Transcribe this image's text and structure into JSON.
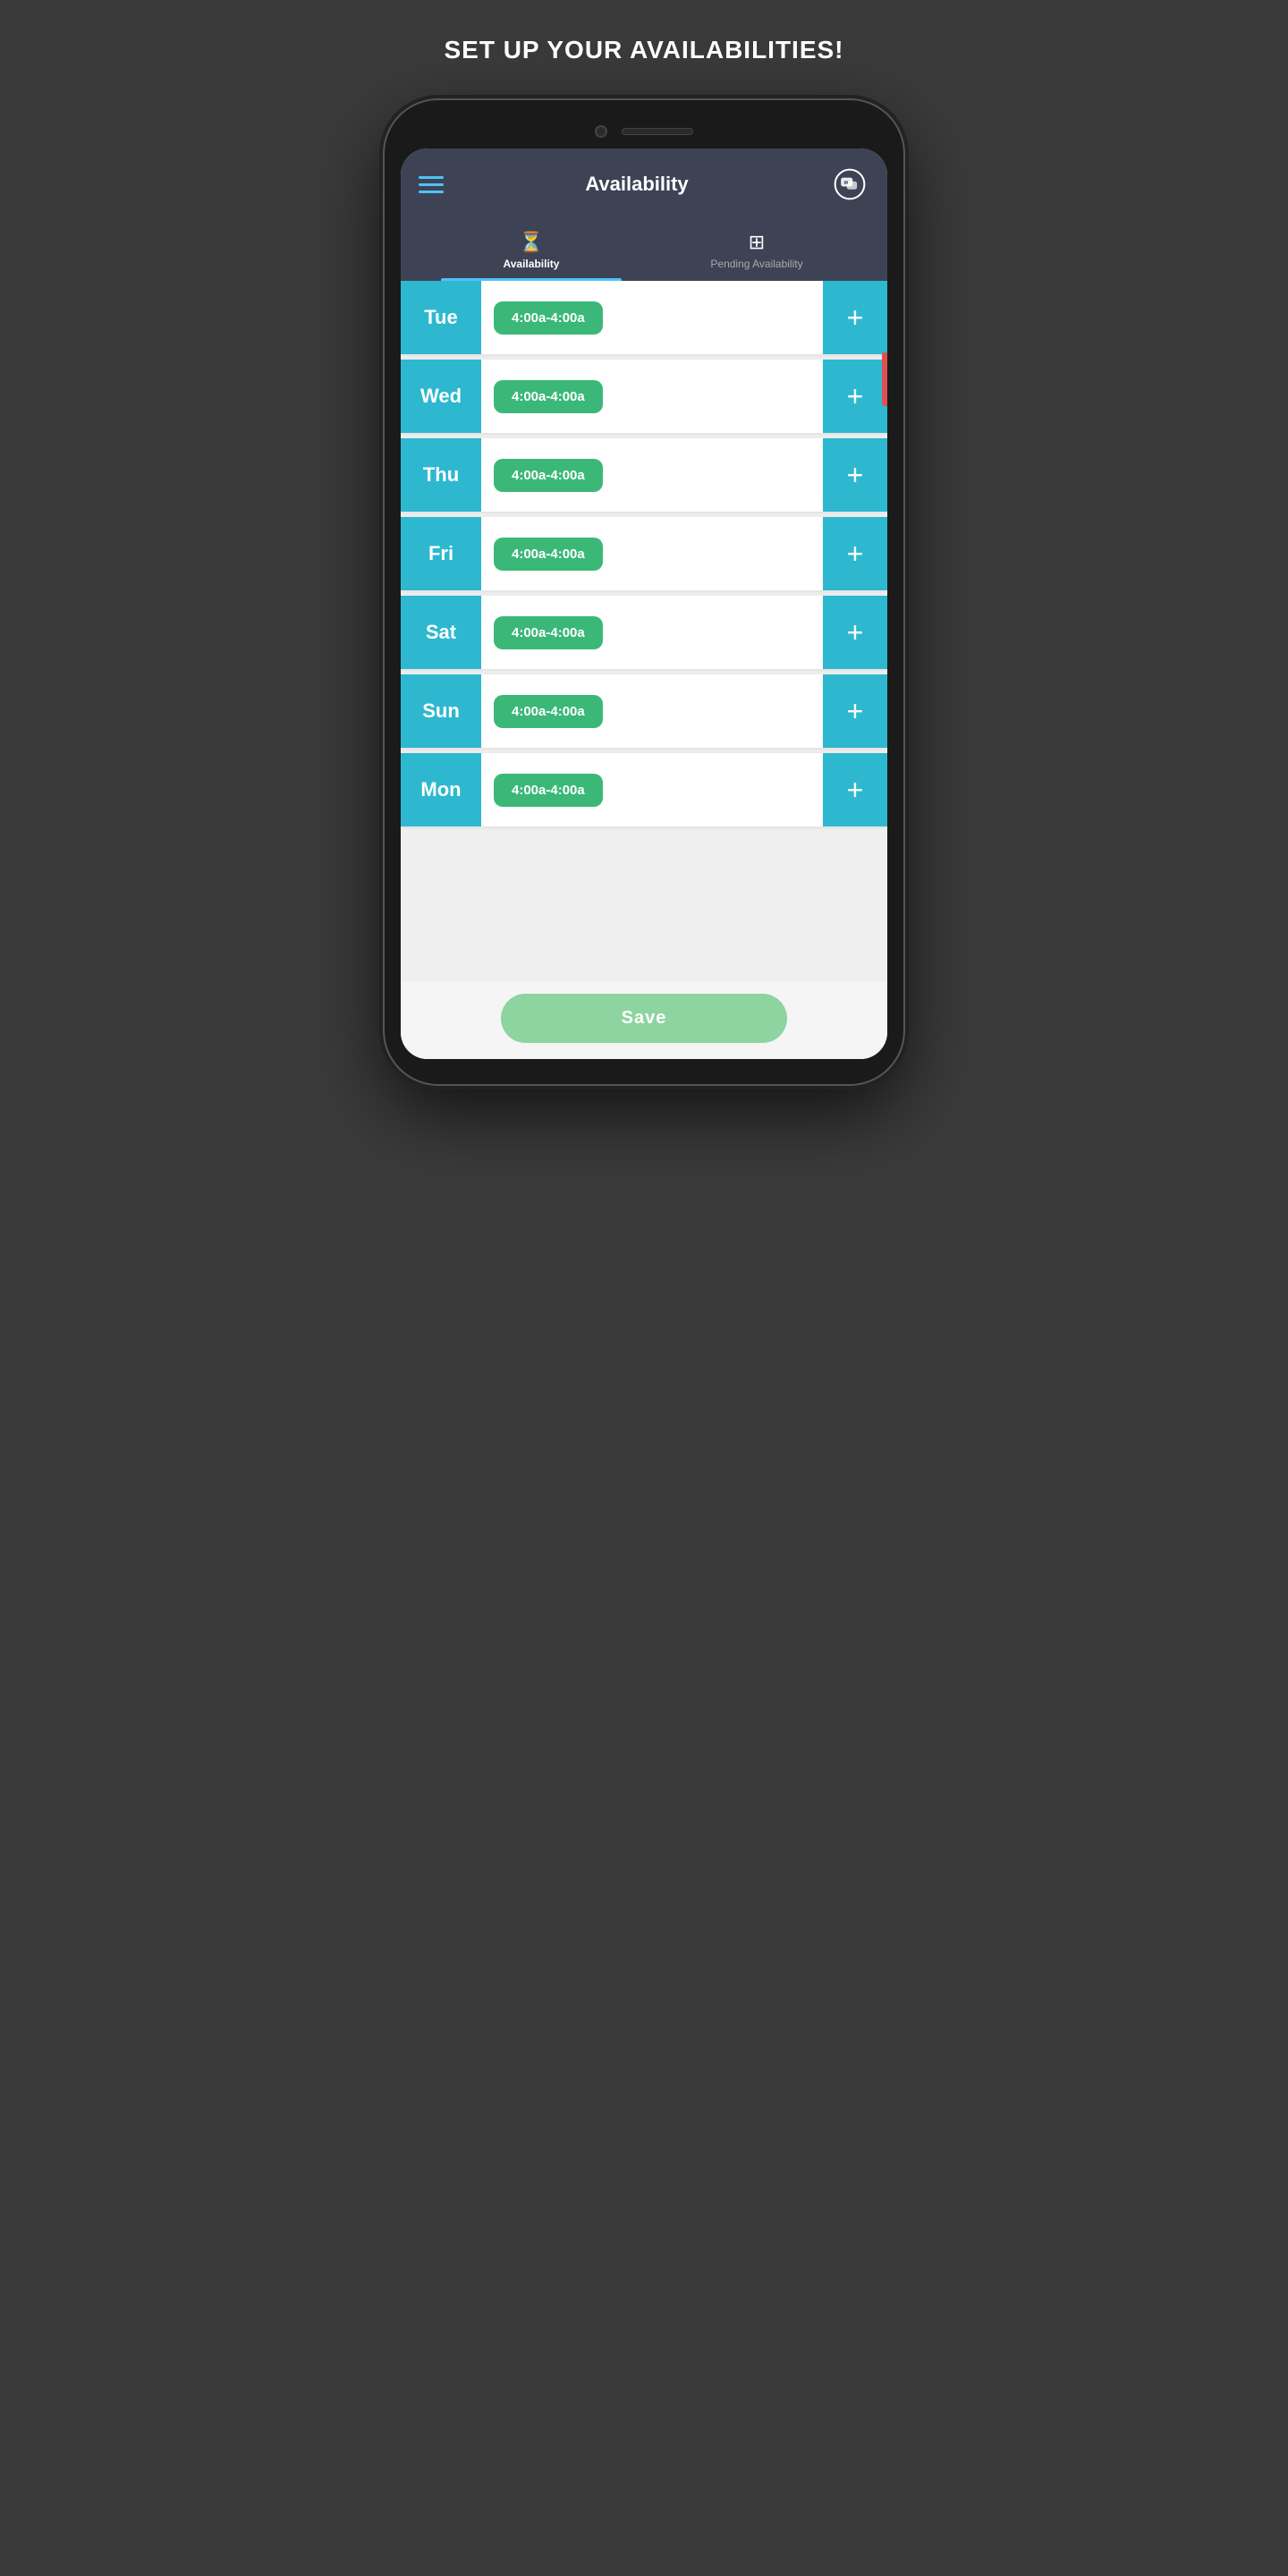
{
  "page": {
    "title": "SET UP YOUR AVAILABILITIES!",
    "bg_color": "#3a3a3a"
  },
  "header": {
    "title": "Availability",
    "hamburger_label": "menu",
    "chat_label": "chat"
  },
  "tabs": [
    {
      "id": "availability",
      "label": "Availability",
      "icon": "hourglass",
      "active": true
    },
    {
      "id": "pending",
      "label": "Pending Availability",
      "icon": "grid",
      "active": false
    }
  ],
  "days": [
    {
      "id": "tue",
      "label": "Tue",
      "slots": [
        "4:00a-4:00a"
      ]
    },
    {
      "id": "wed",
      "label": "Wed",
      "slots": [
        "4:00a-4:00a"
      ]
    },
    {
      "id": "thu",
      "label": "Thu",
      "slots": [
        "4:00a-4:00a"
      ]
    },
    {
      "id": "fri",
      "label": "Fri",
      "slots": [
        "4:00a-4:00a"
      ]
    },
    {
      "id": "sat",
      "label": "Sat",
      "slots": [
        "4:00a-4:00a"
      ]
    },
    {
      "id": "sun",
      "label": "Sun",
      "slots": [
        "4:00a-4:00a"
      ]
    },
    {
      "id": "mon",
      "label": "Mon",
      "slots": [
        "4:00a-4:00a"
      ]
    }
  ],
  "save_button": {
    "label": "Save"
  }
}
